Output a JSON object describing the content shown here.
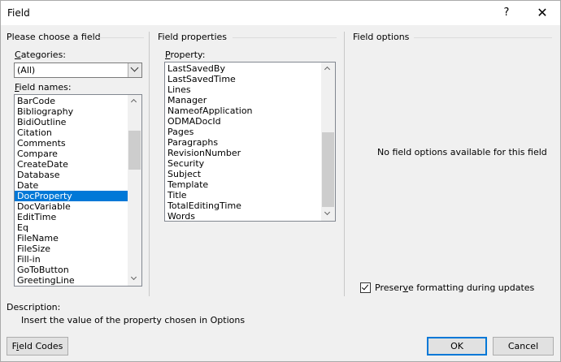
{
  "window": {
    "title": "Field",
    "help_glyph": "?",
    "close_glyph": "✕"
  },
  "choose_field": {
    "header": "Please choose a field",
    "categories_label_accel": "C",
    "categories_label_rest": "ategories:",
    "category_value": "(All)",
    "field_names_label_accel": "F",
    "field_names_label_rest": "ield names:",
    "field_names": [
      "BarCode",
      "Bibliography",
      "BidiOutline",
      "Citation",
      "Comments",
      "Compare",
      "CreateDate",
      "Database",
      "Date",
      "DocProperty",
      "DocVariable",
      "EditTime",
      "Eq",
      "FileName",
      "FileSize",
      "Fill-in",
      "GoToButton",
      "GreetingLine"
    ],
    "selected_field": "DocProperty"
  },
  "field_properties": {
    "header": "Field properties",
    "property_label_accel": "P",
    "property_label_rest": "roperty:",
    "properties": [
      "LastSavedBy",
      "LastSavedTime",
      "Lines",
      "Manager",
      "NameofApplication",
      "ODMADocId",
      "Pages",
      "Paragraphs",
      "RevisionNumber",
      "Security",
      "Subject",
      "Template",
      "Title",
      "TotalEditingTime",
      "Words"
    ]
  },
  "field_options": {
    "header": "Field options",
    "empty_message": "No field options available for this field",
    "preserve_label_accel": "v",
    "preserve_label_pre": "Preser",
    "preserve_label_post": "e formatting during updates",
    "preserve_checked": true
  },
  "description": {
    "label": "Description:",
    "text": "Insert the value of the property chosen in Options"
  },
  "buttons": {
    "field_codes_accel": "i",
    "field_codes_pre": "F",
    "field_codes_post": "eld Codes",
    "ok": "OK",
    "cancel": "Cancel"
  },
  "colors": {
    "selection": "#0078d7",
    "default_button_border": "#0078d7"
  }
}
